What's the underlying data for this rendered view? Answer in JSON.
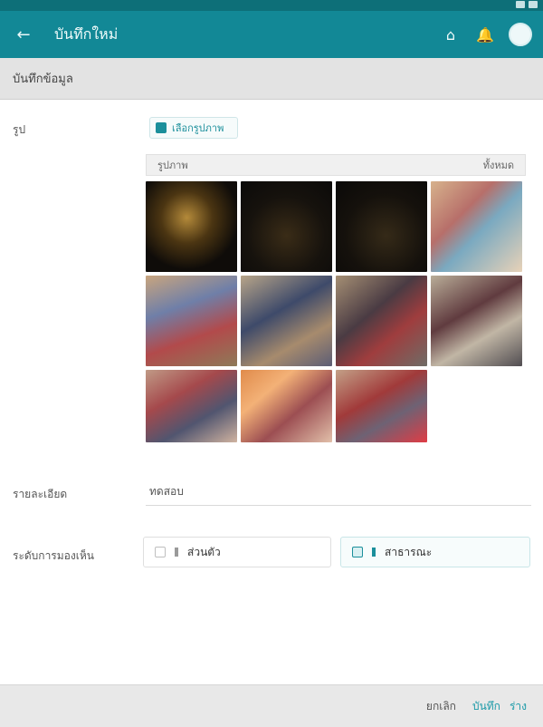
{
  "header": {
    "title": "บันทึกใหม่",
    "back_icon": "arrow-left-icon",
    "actions": [
      "home-icon",
      "bell-icon",
      "avatar"
    ]
  },
  "section": {
    "title": "บันทึกข้อมูล"
  },
  "fields": {
    "photos_label": "รูป",
    "chip_label": "เลือกรูปภาพ",
    "panel_header_left": "รูปภาพ",
    "panel_header_right": "ทั้งหมด",
    "detail_label": "รายละเอียด",
    "detail_value": "ทดสอบ",
    "visibility_label": "ระดับการมองเห็น",
    "option1_label": "ส่วนตัว",
    "option2_label": "สาธารณะ"
  },
  "footer": {
    "cancel_label": "ยกเลิก",
    "save_label": "บันทึก",
    "save_draft_label": "ร่าง"
  },
  "colors": {
    "appbar": "#128896",
    "accent": "#1b8f9b"
  }
}
